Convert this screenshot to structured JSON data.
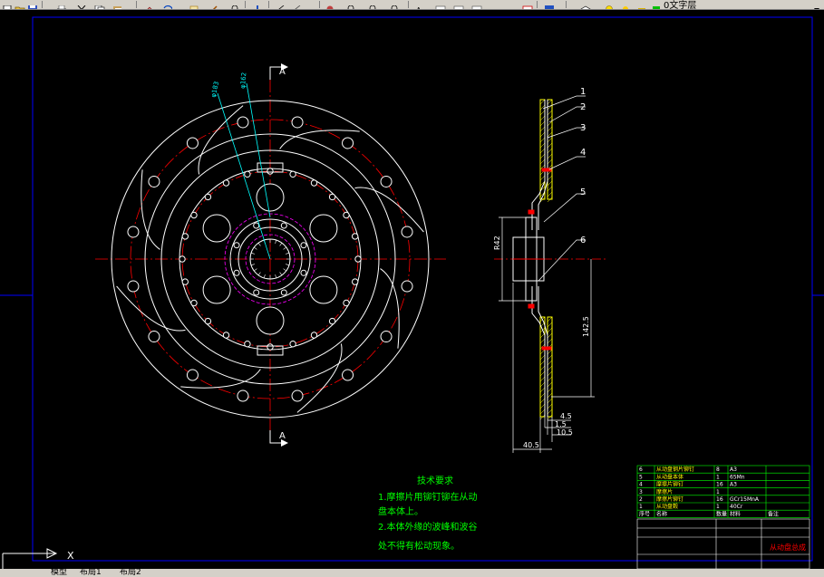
{
  "toolbar": {
    "layer_name": "0文字层",
    "icons": [
      "new-icon",
      "open-icon",
      "save-icon",
      "print-icon",
      "cut-icon",
      "copy-icon",
      "paste-icon",
      "match-icon",
      "undo-icon",
      "pan-icon",
      "zoom-realtime-icon",
      "zoom-window-icon",
      "zoom-previous-icon",
      "properties-icon",
      "design-center-icon",
      "tool-palette-icon",
      "sheet-set-icon",
      "markup-icon",
      "calculator-icon",
      "help-icon",
      "layer-manager-icon",
      "layer-state-icon"
    ]
  },
  "drawing": {
    "section_marker_top": "A",
    "section_marker_bottom": "A",
    "radius_dim": "R42",
    "dim_142_5": "142.5",
    "dim_4_5": "4.5",
    "dim_1_5": "1.5",
    "dim_10_5": "10.5",
    "dim_40_5": "40.5",
    "balloons": [
      "1",
      "2",
      "3",
      "4",
      "5",
      "6"
    ],
    "leader_a": "φ183",
    "leader_b": "φ162",
    "colors": {
      "frame": "#0000ff",
      "outline": "#ffffff",
      "center": "#ff0000",
      "hatch": "#ffff00",
      "hidden": "#ff00ff",
      "leader": "#00ffff",
      "text": "#00ff00"
    }
  },
  "notes": {
    "title": "技术要求",
    "line1": "1.摩擦片用铆钉铆在从动",
    "line2": "盘本体上。",
    "line3": "2.本体外缘的波峰和波谷",
    "line4": "处不得有松动现象。"
  },
  "bom": {
    "rows": [
      {
        "no": "6",
        "name": "从动盘钢片铆钉",
        "qty": "8",
        "mat": "A3"
      },
      {
        "no": "5",
        "name": "从动盘本体",
        "qty": "1",
        "mat": "65Mn"
      },
      {
        "no": "4",
        "name": "摩擦片铆钉",
        "qty": "16",
        "mat": "A3"
      },
      {
        "no": "3",
        "name": "摩擦片",
        "qty": "1",
        "mat": ""
      },
      {
        "no": "2",
        "name": "摩擦片铆钉",
        "qty": "16",
        "mat": "GCr15MnA"
      },
      {
        "no": "1",
        "name": "从动盘毂",
        "qty": "1",
        "mat": "40Cr"
      }
    ],
    "header": {
      "no": "序号",
      "name": "名称",
      "qty": "数量",
      "mat": "材料",
      "note": "备注"
    },
    "title_block": "从动盘总成"
  },
  "status": {
    "axis": "X",
    "tabs": [
      "模型",
      "布局1",
      "布局2"
    ]
  }
}
